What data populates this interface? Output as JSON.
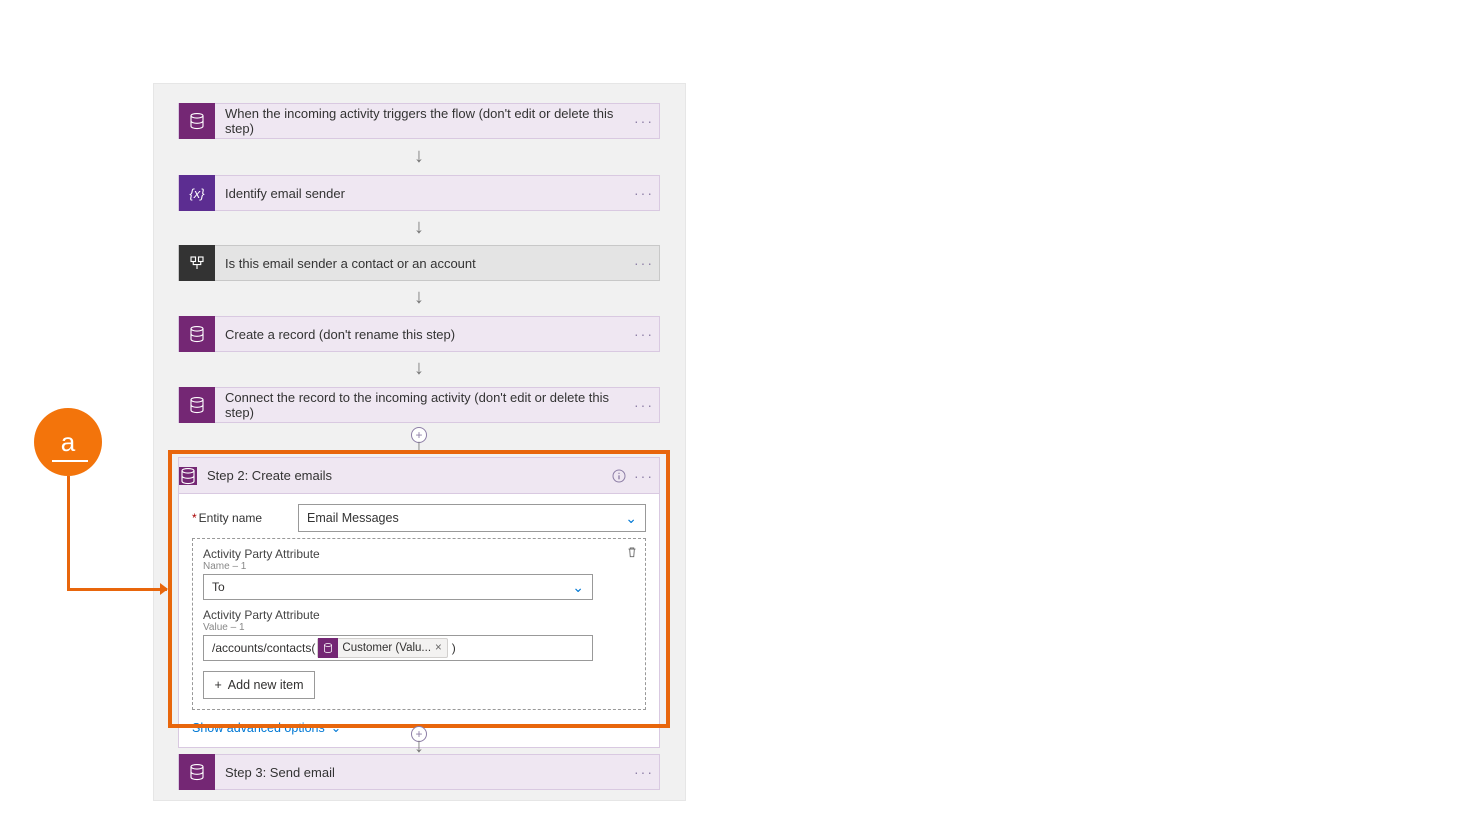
{
  "annotation": {
    "label": "a"
  },
  "steps": {
    "s1": "When the incoming activity triggers the flow (don't edit or delete this step)",
    "s2": "Identify email sender",
    "s3": "Is this email sender a contact or an account",
    "s4": "Create a record (don't rename this step)",
    "s5": "Connect the record to the incoming activity (don't edit or delete this step)",
    "s6": "Step 2: Create emails",
    "s7": "Step 3: Send email"
  },
  "card": {
    "entity_label": "Entity name",
    "entity_value": "Email Messages",
    "ap_name_label": "Activity Party Attribute",
    "ap_name_sub": "Name – 1",
    "ap_name_value": "To",
    "ap_val_label": "Activity Party Attribute",
    "ap_val_sub": "Value – 1",
    "ap_val_prefix": "/accounts/contacts(",
    "ap_val_suffix": ")",
    "token_label": "Customer (Valu...",
    "add_item": "Add new item",
    "show_adv": "Show advanced options"
  }
}
